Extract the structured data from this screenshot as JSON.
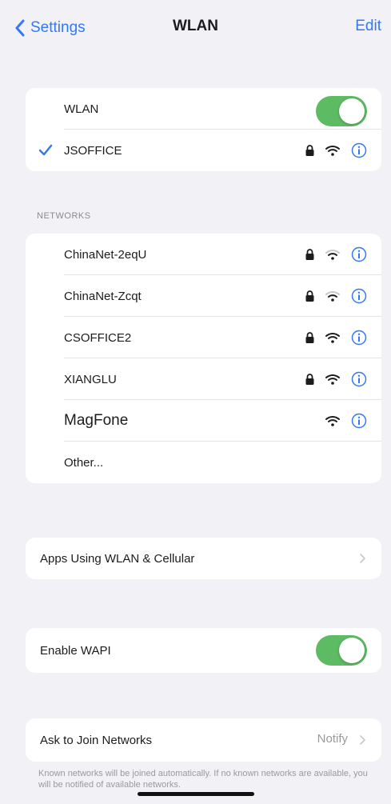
{
  "nav": {
    "back_label": "Settings",
    "title": "WLAN",
    "edit_label": "Edit"
  },
  "wlan_card": {
    "toggle_label": "WLAN",
    "toggle_on": true,
    "connected_network": "JSOFFICE"
  },
  "networks_header": "NETWORKS",
  "networks": [
    {
      "name": "ChinaNet-2eqU",
      "locked": true
    },
    {
      "name": "ChinaNet-Zcqt",
      "locked": true
    },
    {
      "name": "CSOFFICE2",
      "locked": true
    },
    {
      "name": "XIANGLU",
      "locked": true
    },
    {
      "name": "MagFone",
      "locked": false
    },
    {
      "name": "Other...",
      "locked": false
    }
  ],
  "apps_row": {
    "label": "Apps Using WLAN & Cellular"
  },
  "wapi_row": {
    "label": "Enable WAPI",
    "toggle_on": true
  },
  "ask_join": {
    "label": "Ask to Join Networks",
    "value": "Notify"
  },
  "footer": "Known networks will be joined automatically. If no known networks are available, you will be notified of available networks.",
  "colors": {
    "accent": "#3478f6",
    "toggle_on": "#5dbb63",
    "background": "#f2f2f6"
  }
}
